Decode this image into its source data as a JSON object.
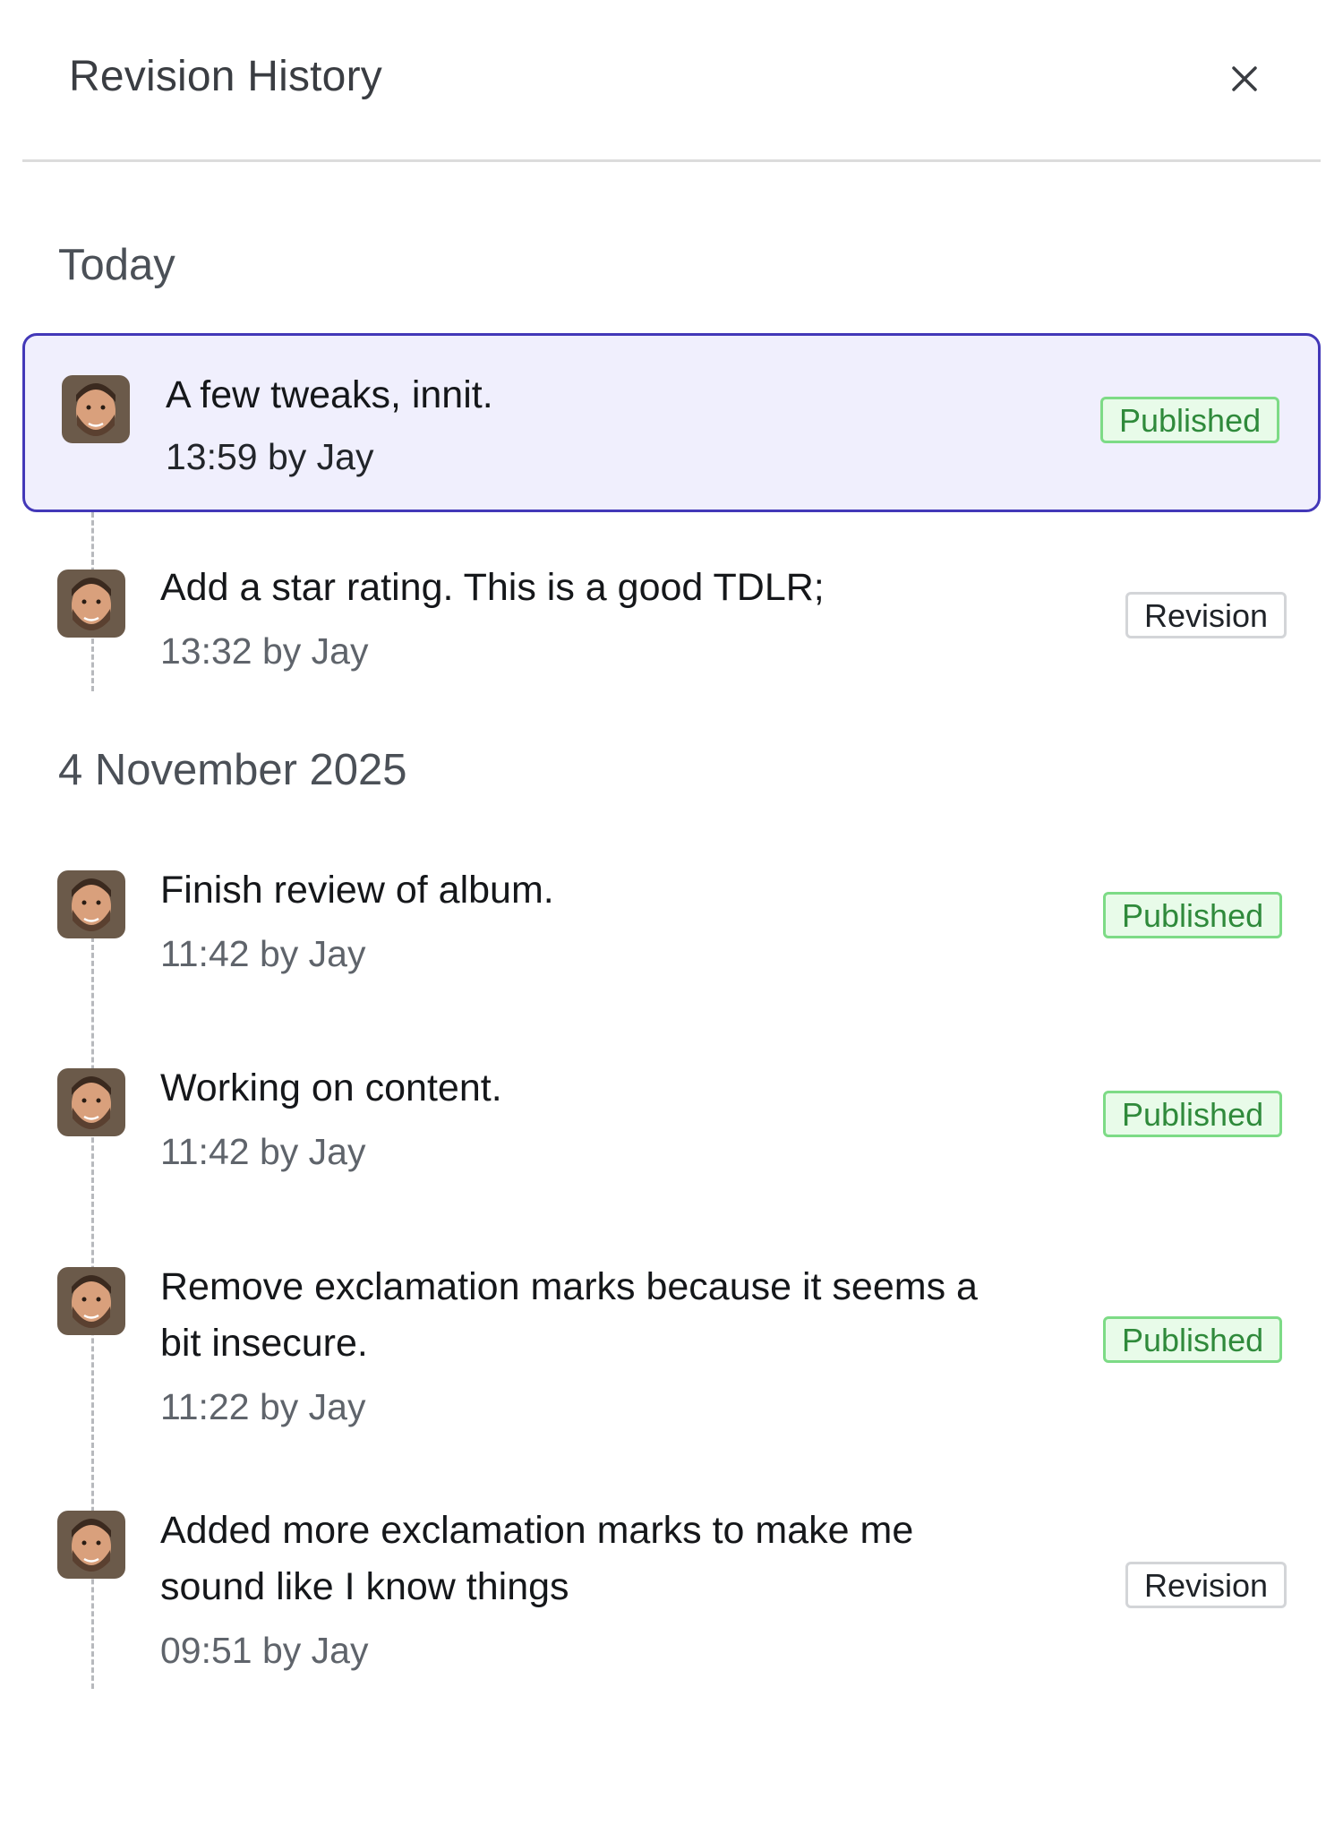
{
  "header": {
    "title": "Revision History"
  },
  "groups": [
    {
      "label": "Today",
      "entries": [
        {
          "message": "A few tweaks, innit.",
          "meta": "13:59 by Jay",
          "status": "Published"
        },
        {
          "message": "Add a star rating. This is a good TDLR;",
          "meta": "13:32 by Jay",
          "status": "Revision"
        }
      ]
    },
    {
      "label": "4 November 2025",
      "entries": [
        {
          "message": "Finish review of album.",
          "meta": "11:42 by Jay",
          "status": "Published"
        },
        {
          "message": "Working on content.",
          "meta": "11:42 by Jay",
          "status": "Published"
        },
        {
          "message_line1": "Remove exclamation marks because it seems a",
          "message_line2": "bit insecure.",
          "meta": "11:22 by Jay",
          "status": "Published"
        },
        {
          "message_line1": "Added more exclamation marks to make me",
          "message_line2": "sound like I know things",
          "meta": "09:51 by Jay",
          "status": "Revision"
        }
      ]
    }
  ],
  "colors": {
    "selected_bg": "#f0effd",
    "selected_border": "#4338b8",
    "published_text": "#2f8a3b",
    "published_bg": "#e8fbe9"
  }
}
